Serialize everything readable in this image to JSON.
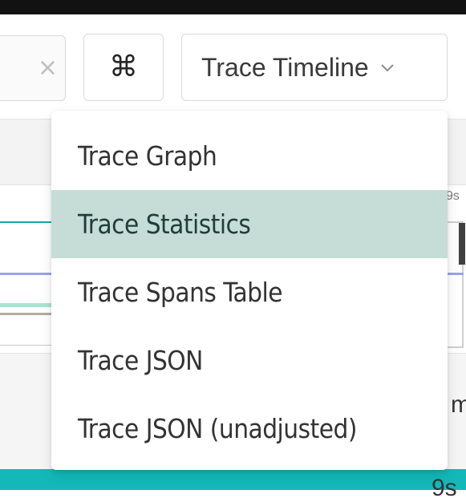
{
  "toolbar": {
    "clear_icon": "close-icon",
    "clear_glyph": "×",
    "shortcut_icon": "command-key-icon",
    "shortcut_glyph": "⌘",
    "view_select": {
      "selected": "Trace Timeline",
      "icon": "chevron-down-icon"
    }
  },
  "dropdown": {
    "items": [
      {
        "label": "Trace Graph",
        "active": false
      },
      {
        "label": "Trace Statistics",
        "active": true
      },
      {
        "label": "Trace Spans Table",
        "active": false
      },
      {
        "label": "Trace JSON",
        "active": false
      },
      {
        "label": "Trace JSON (unadjusted)",
        "active": false
      }
    ]
  },
  "background": {
    "tick_label": "9s",
    "edge_text": "m",
    "bottom_label": "9s"
  },
  "colors": {
    "active_item_bg": "#c6dcd7",
    "teal_bar": "#14b8b8"
  }
}
